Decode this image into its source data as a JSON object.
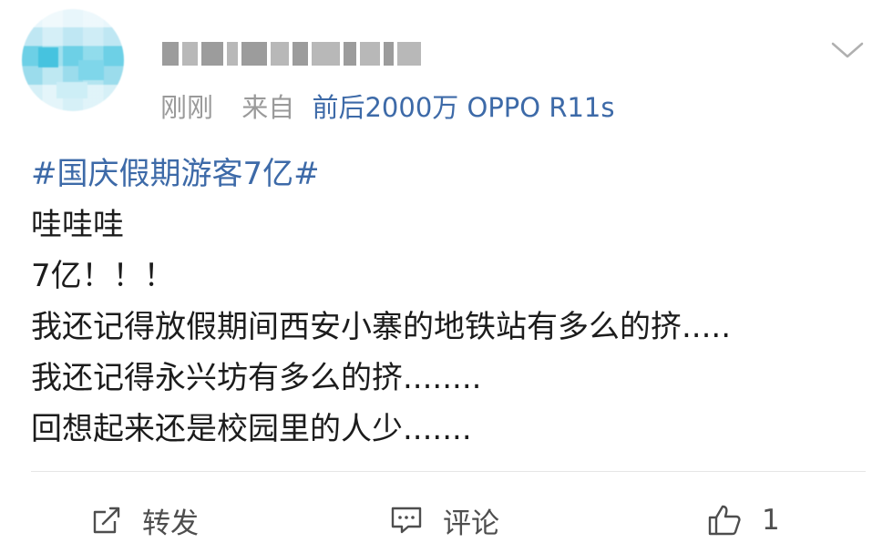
{
  "header": {
    "time": "刚刚",
    "from_label": "来自",
    "device": "前后2000万 OPPO R11s"
  },
  "post": {
    "lines": [
      "#国庆假期游客7亿#",
      "哇哇哇",
      "7亿！！！",
      "我还记得放假期间西安小寨的地铁站有多么的挤.....",
      "我还记得永兴坊有多么的挤........",
      "回想起来还是校园里的人少......."
    ]
  },
  "actions": {
    "repost_label": "转发",
    "comment_label": "评论",
    "like_count": "1"
  },
  "colors": {
    "link": "#3d6aa8",
    "meta": "#9a9a9a",
    "text": "#1c1c1c",
    "icon": "#4e4e4e"
  }
}
